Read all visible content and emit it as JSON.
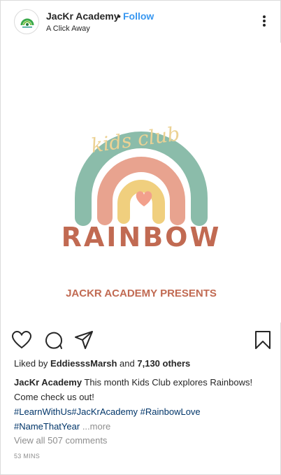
{
  "header": {
    "username": "JacKr Academy",
    "dot": "•",
    "follow_label": "Follow",
    "location": "A Click Away"
  },
  "post": {
    "image_title_script": "kids club",
    "image_title_main": "RAINBOW",
    "image_subtitle": "JACKR ACADEMY PRESENTS"
  },
  "likes": {
    "prefix": "Liked by",
    "user": "EddiesssMarsh",
    "and": "and",
    "count": "7,130 others"
  },
  "caption": {
    "username": "JacKr Academy",
    "text": "This month Kids Club explores Rainbows! Come check us out!",
    "tags": [
      "#LearnWithUs",
      "#JacKrAcademy",
      "#RainbowLove",
      "#NameThatYear"
    ],
    "more_label": "...more"
  },
  "comments": {
    "label": "View all 507 comments"
  },
  "time": {
    "label": "53 MINS"
  },
  "icons": {
    "heart": "heart-icon",
    "comment": "comment-icon",
    "share": "share-icon",
    "save": "bookmark-icon",
    "more": "more-vertical-icon"
  },
  "colors": {
    "follow": "#3897f0",
    "hashtag": "#003569",
    "arc_outer": "#8bbcaa",
    "arc_middle": "#e8a38f",
    "arc_inner": "#f0cf7e",
    "heart": "#f2a08c",
    "rainbow_text": "#c16a52",
    "script_text": "#ecd294"
  }
}
